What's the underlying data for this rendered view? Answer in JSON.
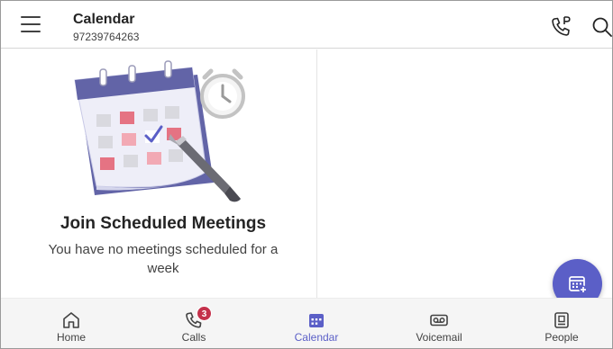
{
  "header": {
    "title": "Calendar",
    "subtitle": "97239764263",
    "icons": [
      "menu-icon",
      "call-park-icon",
      "search-icon"
    ]
  },
  "empty_state": {
    "title": "Join Scheduled Meetings",
    "description": "You have no meetings scheduled for a week"
  },
  "fab": {
    "icon": "new-meeting-icon"
  },
  "nav": {
    "items": [
      {
        "label": "Home",
        "icon": "home-icon"
      },
      {
        "label": "Calls",
        "icon": "phone-icon",
        "badge": "3"
      },
      {
        "label": "Calendar",
        "icon": "calendar-icon",
        "active": true
      },
      {
        "label": "Voicemail",
        "icon": "voicemail-icon"
      },
      {
        "label": "People",
        "icon": "people-icon"
      }
    ]
  },
  "colors": {
    "accent": "#5b5fc7",
    "badge": "#c4314b",
    "nav_background": "#f5f5f5"
  }
}
